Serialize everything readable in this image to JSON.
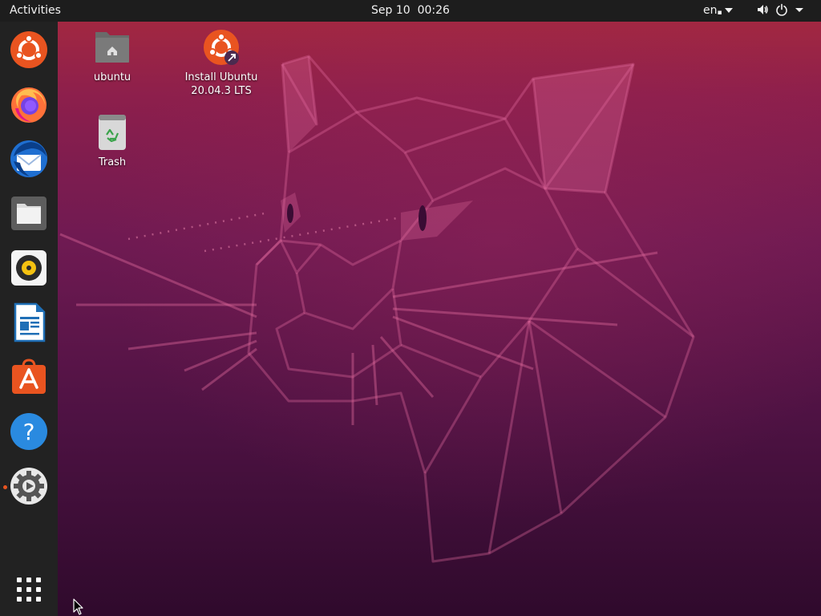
{
  "topbar": {
    "activities_label": "Activities",
    "date": "Sep 10",
    "time": "00:26",
    "language": "en",
    "icons": [
      "volume-icon",
      "power-icon",
      "system-menu-caret-icon"
    ]
  },
  "dock": {
    "apps": [
      {
        "name": "Install Ubuntu 20.04.3 LTS",
        "icon": "ubuntu-installer-icon"
      },
      {
        "name": "Firefox Web Browser",
        "icon": "firefox-icon"
      },
      {
        "name": "Thunderbird Mail",
        "icon": "thunderbird-icon"
      },
      {
        "name": "Files",
        "icon": "files-icon"
      },
      {
        "name": "Rhythmbox",
        "icon": "rhythmbox-icon"
      },
      {
        "name": "LibreOffice Writer",
        "icon": "libreoffice-writer-icon"
      },
      {
        "name": "Ubuntu Software",
        "icon": "ubuntu-software-icon"
      },
      {
        "name": "Help",
        "icon": "help-icon"
      },
      {
        "name": "Settings",
        "icon": "settings-icon",
        "running": true
      }
    ],
    "show_apps_icon": "show-applications-icon"
  },
  "desktop": {
    "icons": [
      {
        "label": "ubuntu",
        "icon": "home-folder-icon"
      },
      {
        "label": "Install Ubuntu\n20.04.3 LTS",
        "line1": "Install Ubuntu",
        "line2": "20.04.3 LTS",
        "icon": "ubuntu-installer-icon"
      },
      {
        "label": "Trash",
        "icon": "trash-icon"
      }
    ]
  },
  "colors": {
    "accent": "#e95420",
    "topbar_bg": "#1d1d1d",
    "dock_bg": "#222222",
    "wallpaper_top": "#a82a3e",
    "wallpaper_bottom": "#2f0a2c"
  }
}
